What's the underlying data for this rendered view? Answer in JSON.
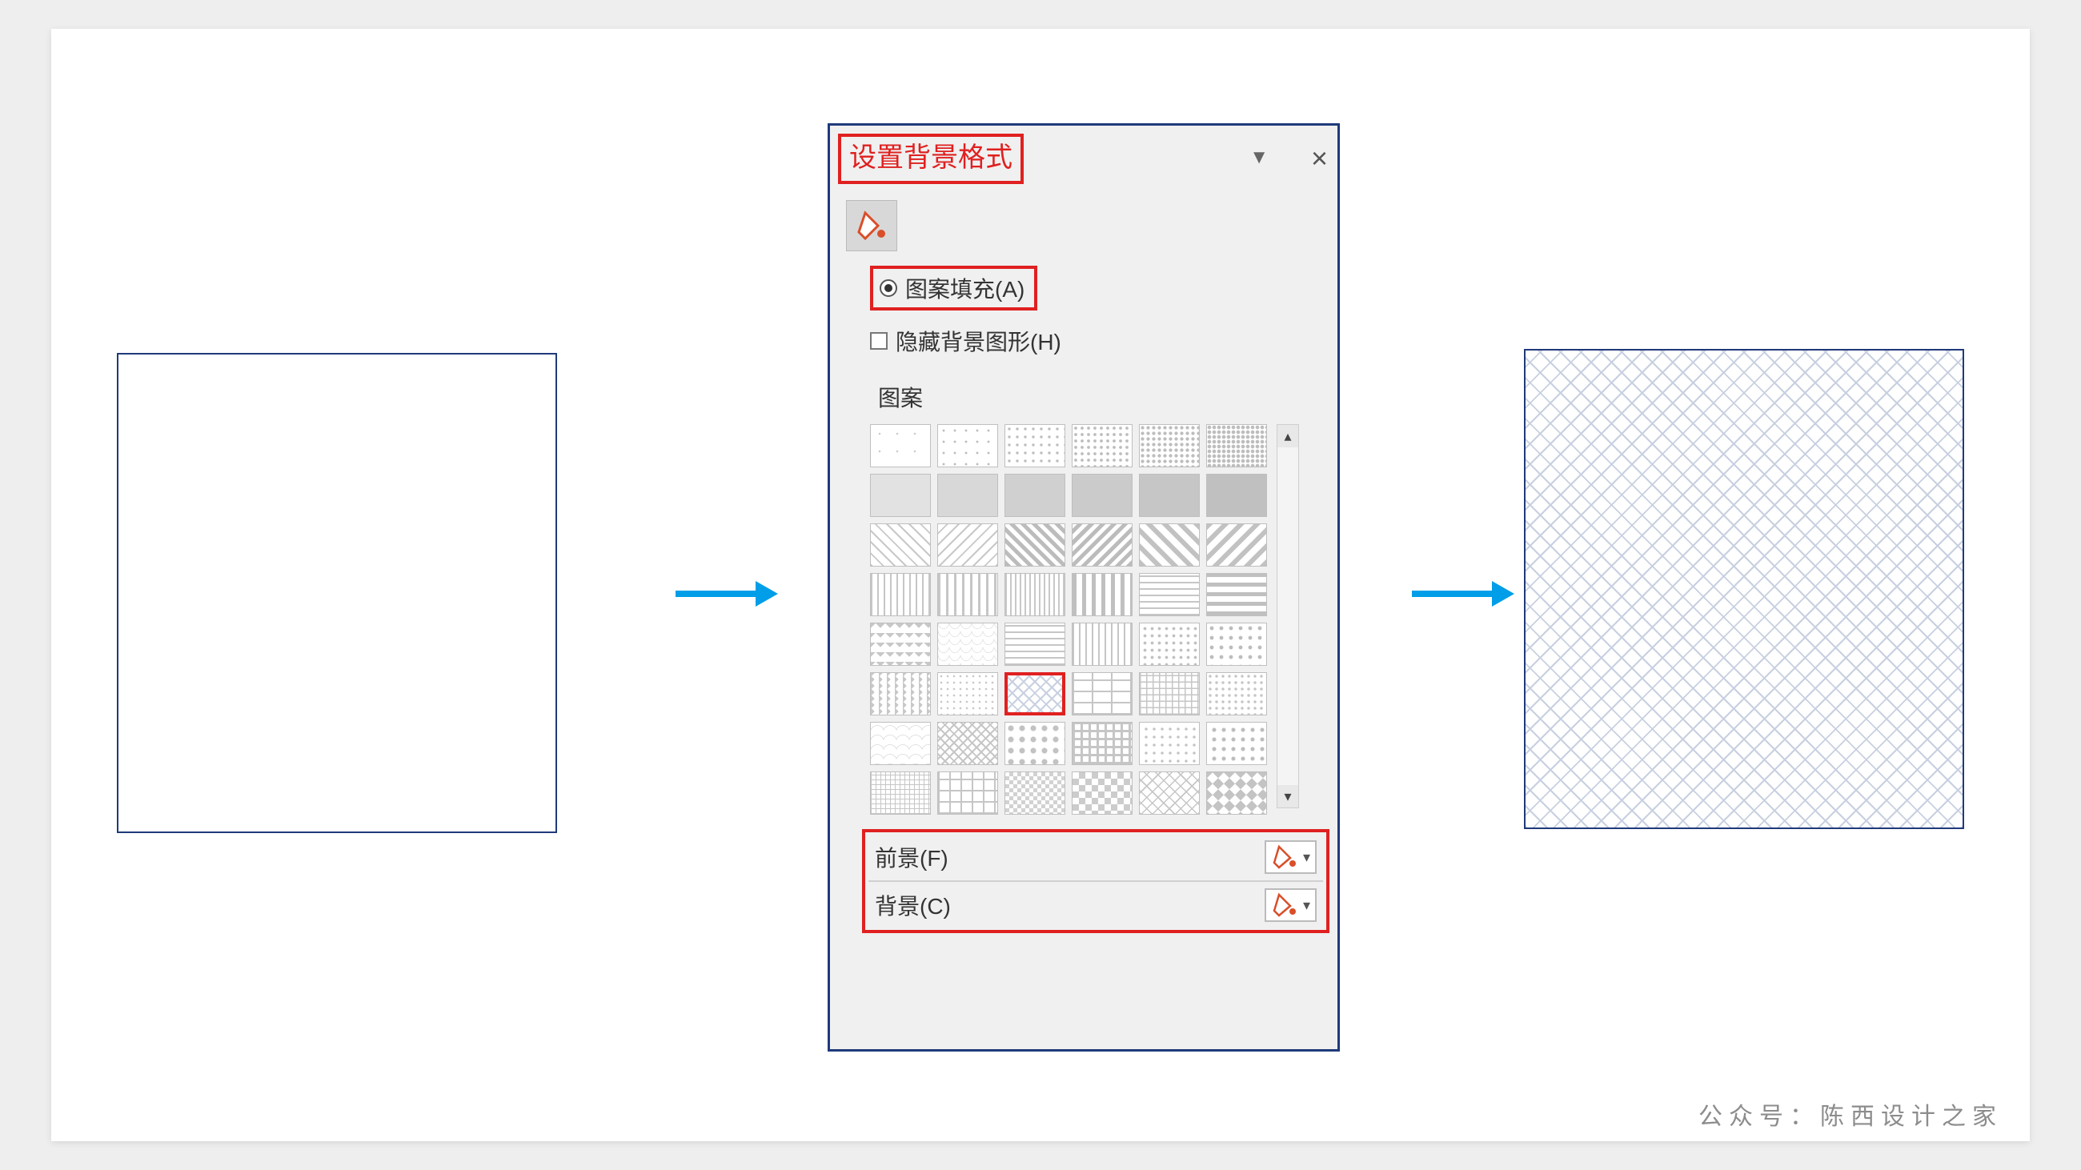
{
  "credit_text": "公众号：陈西设计之家",
  "panel": {
    "title": "设置背景格式",
    "close_glyph": "×",
    "menu_glyph": "▼",
    "fill_option": "图案填充(A)",
    "hide_bg_option": "隐藏背景图形(H)",
    "section_label": "图案",
    "scroll_up": "▴",
    "scroll_down": "▾"
  },
  "color_rows": {
    "foreground_label": "前景(F)",
    "background_label": "背景(C)",
    "dropdown_glyph": "▾"
  },
  "highlight": {
    "reds": "#e02020",
    "accent": "#d94f2a"
  }
}
